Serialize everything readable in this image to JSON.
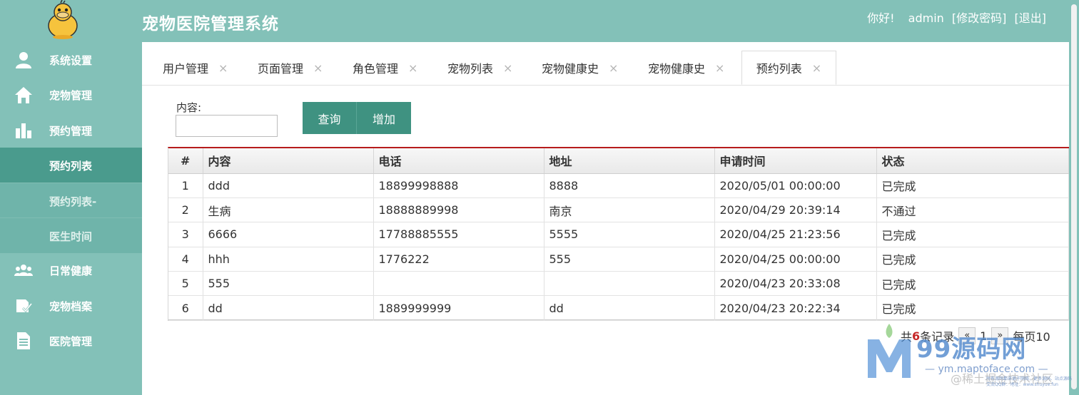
{
  "header": {
    "title": "宠物医院管理系统",
    "greeting": "你好!",
    "username": "admin",
    "change_password": "[修改密码]",
    "logout": "[退出]"
  },
  "sidebar": {
    "items": [
      {
        "label": "系统设置",
        "icon": "user-icon"
      },
      {
        "label": "宠物管理",
        "icon": "home-icon"
      },
      {
        "label": "预约管理",
        "icon": "bar-chart-icon"
      },
      {
        "label": "预约列表",
        "icon": "",
        "sub": true,
        "active": true
      },
      {
        "label": "预约列表-",
        "icon": "",
        "sub": true
      },
      {
        "label": "医生时间",
        "icon": "",
        "sub": true
      },
      {
        "label": "日常健康",
        "icon": "users-icon"
      },
      {
        "label": "宠物档案",
        "icon": "edit-check-icon"
      },
      {
        "label": "医院管理",
        "icon": "document-icon"
      }
    ]
  },
  "tabs": [
    {
      "label": "用户管理"
    },
    {
      "label": "页面管理"
    },
    {
      "label": "角色管理"
    },
    {
      "label": "宠物列表"
    },
    {
      "label": "宠物健康史"
    },
    {
      "label": "宠物健康史"
    },
    {
      "label": "预约列表",
      "active": true
    }
  ],
  "tab_close_glyph": "×",
  "search": {
    "label": "内容:",
    "value": "",
    "query_button": "查询",
    "add_button": "增加"
  },
  "table": {
    "headers": [
      "#",
      "内容",
      "电话",
      "地址",
      "申请时间",
      "状态"
    ],
    "rows": [
      [
        "1",
        "ddd",
        "18899998888",
        "8888",
        "2020/05/01 00:00:00",
        "已完成"
      ],
      [
        "2",
        "生病",
        "18888889998",
        "南京",
        "2020/04/29 20:39:14",
        "不通过"
      ],
      [
        "3",
        "6666",
        "17788885555",
        "5555",
        "2020/04/25 21:23:56",
        "已完成"
      ],
      [
        "4",
        "hhh",
        "1776222",
        "555",
        "2020/04/25 00:00:00",
        "已完成"
      ],
      [
        "5",
        "555",
        "",
        "",
        "2020/04/23 20:33:08",
        "已完成"
      ],
      [
        "6",
        "dd",
        "1889999999",
        "dd",
        "2020/04/23 20:22:34",
        "已完成"
      ]
    ]
  },
  "pager": {
    "prefix": "共",
    "count": "6",
    "suffix": "条记录",
    "page": "1",
    "prev": "«",
    "next": "»",
    "per_page": "每页10"
  },
  "watermark": {
    "brand": "99源码网",
    "url": "— ym.maptoface.com —",
    "tag": "@稀土掘金技术社区",
    "note": "所有源码都来源于网络，更多源码、站点源码交流QQ群：地址：www.shuyue.fun"
  },
  "colors": {
    "header_bg": "#83c1b8",
    "sidebar_active": "#4a9b8d",
    "button_bg": "#3f9281",
    "table_top_border": "#b71c1c"
  }
}
